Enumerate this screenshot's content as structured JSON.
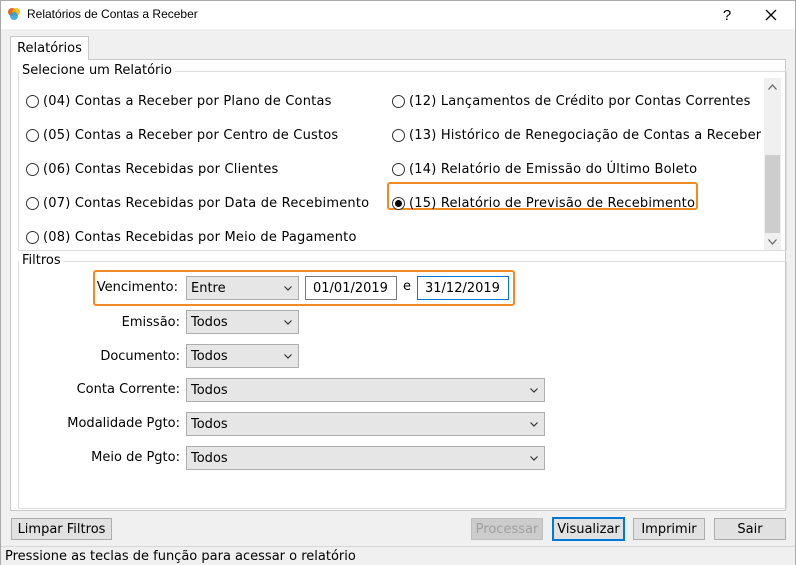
{
  "window": {
    "title": "Relatórios de Contas a Receber",
    "help_label": "?",
    "close_label": "✕"
  },
  "tabs": [
    {
      "label": "Relatórios",
      "selected": true
    }
  ],
  "report_group": {
    "legend": "Selecione um Relatório",
    "items": [
      {
        "label": "(04) Contas a Receber por Plano de Contas",
        "checked": false
      },
      {
        "label": "(05) Contas a Receber por Centro de Custos",
        "checked": false
      },
      {
        "label": "(06) Contas Recebidas por Clientes",
        "checked": false
      },
      {
        "label": "(07) Contas Recebidas por Data de Recebimento",
        "checked": false
      },
      {
        "label": "(08) Contas Recebidas por Meio de Pagamento",
        "checked": false
      },
      {
        "label": "(12) Lançamentos de Crédito por Contas Correntes",
        "checked": false
      },
      {
        "label": "(13) Histórico de Renegociação de Contas a Receber",
        "checked": false
      },
      {
        "label": "(14) Relatório de Emissão do Último Boleto",
        "checked": false
      },
      {
        "label": "(15) Relatório de Previsão de Recebimento",
        "checked": true
      }
    ]
  },
  "filters": {
    "legend": "Filtros",
    "vencimento": {
      "label": "Vencimento:",
      "mode": "Entre",
      "from": "01/01/2019",
      "sep": "e",
      "to": "31/12/2019"
    },
    "emissao": {
      "label": "Emissão:",
      "value": "Todos"
    },
    "documento": {
      "label": "Documento:",
      "value": "Todos"
    },
    "conta_corrente": {
      "label": "Conta Corrente:",
      "value": "Todos"
    },
    "modalidade": {
      "label": "Modalidade Pgto:",
      "value": "Todos"
    },
    "meio_pgto": {
      "label": "Meio de Pgto:",
      "value": "Todos"
    }
  },
  "buttons": {
    "limpar": "Limpar Filtros",
    "processar": "Processar",
    "visualizar": "Visualizar",
    "imprimir": "Imprimir",
    "sair": "Sair"
  },
  "status": "Pressione as teclas de função para acessar o relatório",
  "colors": {
    "highlight": "#f08a24",
    "focus": "#0078d7"
  }
}
